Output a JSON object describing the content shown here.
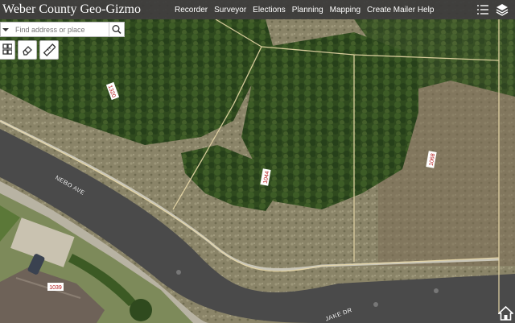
{
  "app": {
    "title": "Weber County Geo-Gizmo"
  },
  "nav": [
    {
      "label": "Recorder"
    },
    {
      "label": "Surveyor"
    },
    {
      "label": "Elections"
    },
    {
      "label": "Planning"
    },
    {
      "label": "Mapping"
    },
    {
      "label": "Create Mailer Help"
    }
  ],
  "toolbar_icons": [
    "list-icon",
    "layers-icon"
  ],
  "search": {
    "placeholder": "Find address or place",
    "icon": "search-icon",
    "dropdown_icon": "caret-down-icon"
  },
  "map_tools": [
    "basemap-grid-icon",
    "eraser-icon",
    "ruler-icon"
  ],
  "map": {
    "street_labels": [
      "NEBO AVE",
      "JAKE DR"
    ],
    "parcel_labels": [
      "1320",
      "1044",
      "1068",
      "1039"
    ],
    "home_icon": "home-icon",
    "colors": {
      "parcel_line": "#e8d8a8",
      "parcel_label_bg": "#ffffff",
      "parcel_label_text": "#b01010",
      "road": "#4a4a4a",
      "topbar": "#3a3a3a"
    }
  }
}
